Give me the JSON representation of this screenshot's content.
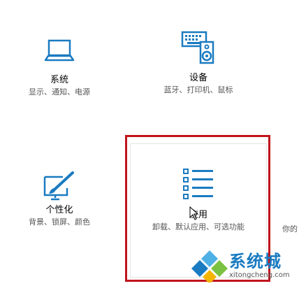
{
  "tiles": {
    "system": {
      "title": "系统",
      "desc": "显示、通知、电源",
      "icon": "laptop-icon"
    },
    "devices": {
      "title": "设备",
      "desc": "蓝牙、打印机、鼠标",
      "icon": "keyboard-speaker-icon"
    },
    "personalization": {
      "title": "个性化",
      "desc": "背景、锁屏、颜色",
      "icon": "paint-brush-icon"
    },
    "apps": {
      "title": "应用",
      "desc": "卸载、默认应用、可选功能",
      "icon": "list-icon"
    }
  },
  "partial_tile": {
    "desc": "你的"
  },
  "watermark": {
    "text": "系统城",
    "url": "xitongcheng.com"
  },
  "colors": {
    "accent": "#1a7bc1",
    "highlight_border": "#c0141b"
  }
}
